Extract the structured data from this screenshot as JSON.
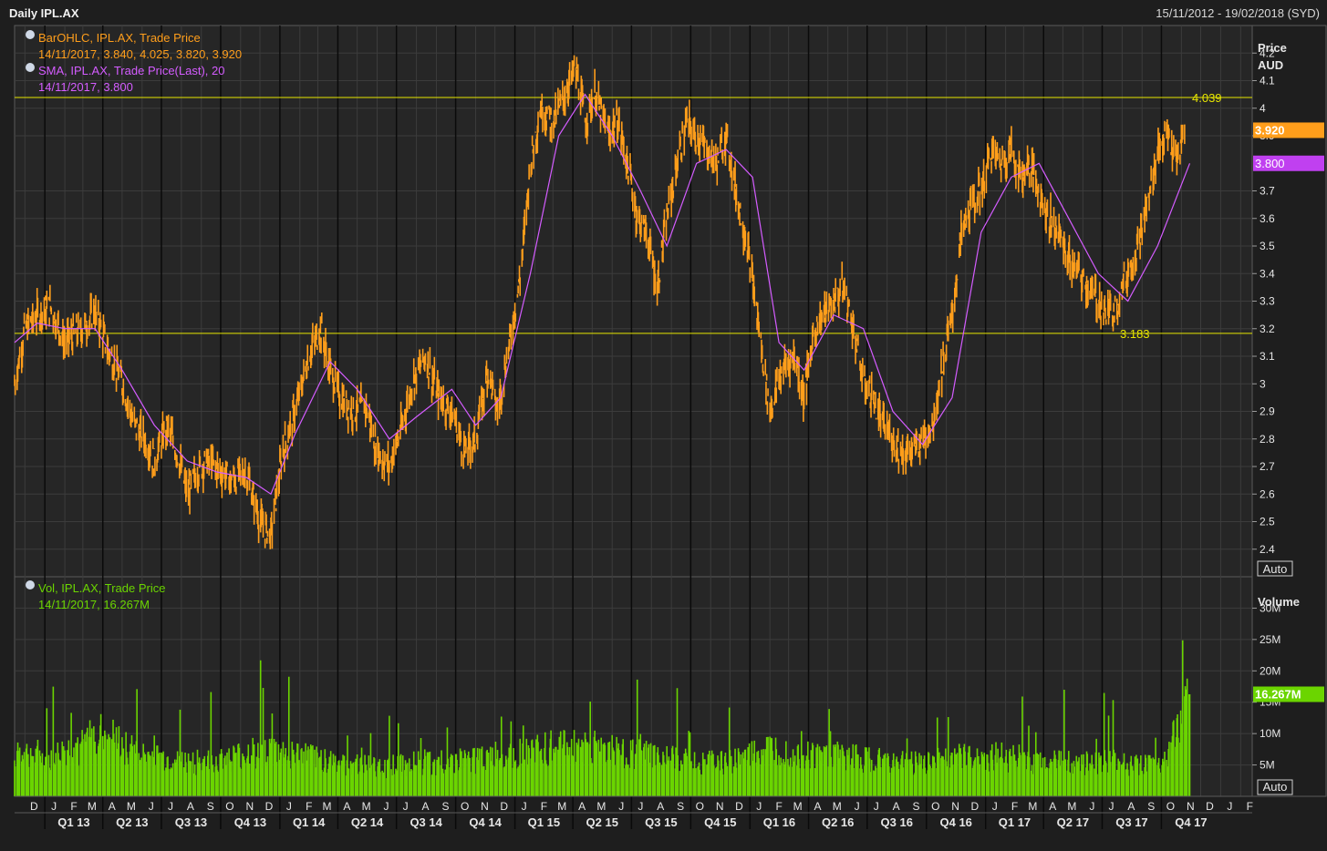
{
  "header": {
    "title": "Daily IPL.AX",
    "date_range": "15/11/2012 - 19/02/2018 (SYD)"
  },
  "price_panel": {
    "axis_title": "Price",
    "axis_unit": "AUD",
    "auto_label": "Auto",
    "legend": [
      {
        "name": "BarOHLC, IPL.AX, Trade Price",
        "value": "14/11/2017, 3.840, 4.025, 3.820, 3.920",
        "color": "#ff9e1b"
      },
      {
        "name": "SMA, IPL.AX, Trade Price(Last),  20",
        "value": "14/11/2017, 3.800",
        "color": "#d45cff"
      }
    ],
    "last_price_label": "3.920",
    "sma_label": "3.800",
    "high_line": {
      "value": 4.039,
      "label": "4.039"
    },
    "low_line": {
      "value": 3.183,
      "label": "3.183"
    }
  },
  "volume_panel": {
    "axis_title": "Volume",
    "auto_label": "Auto",
    "legend": {
      "name": "Vol, IPL.AX, Trade Price",
      "value": "14/11/2017, 16.267M",
      "color": "#6bd500"
    },
    "last_label": "16.267M"
  },
  "colors": {
    "background": "#1e1e1e",
    "grid": "#3c3c3c",
    "price": "#ff9e1b",
    "sma": "#d45cff",
    "volume": "#6bd500",
    "level_line": "#e7e600",
    "axis_text": "#e6e6e6"
  },
  "chart_data": {
    "type": "line",
    "title": "Daily IPL.AX",
    "x_range": [
      "2012-11-15",
      "2018-02-19"
    ],
    "price_ylim": [
      2.3,
      4.3
    ],
    "price_yticks": [
      2.4,
      2.5,
      2.6,
      2.7,
      2.8,
      2.9,
      3,
      3.1,
      3.2,
      3.3,
      3.4,
      3.5,
      3.6,
      3.7,
      3.9,
      4,
      4.1,
      4.2
    ],
    "price_ytick_labels": [
      "2.4",
      "2.5",
      "2.6",
      "2.7",
      "2.8",
      "2.9",
      "3",
      "3.1",
      "3.2",
      "3.3",
      "3.4",
      "3.5",
      "3.6",
      "3.7",
      "3.9",
      "4",
      "4.1",
      "4.2"
    ],
    "volume_ylim": [
      0,
      35
    ],
    "volume_yticks": [
      5,
      10,
      15,
      20,
      25,
      30
    ],
    "volume_ytick_labels": [
      "5M",
      "10M",
      "15M",
      "20M",
      "25M",
      "30M"
    ],
    "months": [
      "D",
      "J",
      "F",
      "M",
      "A",
      "M",
      "J",
      "J",
      "A",
      "S",
      "O",
      "N",
      "D",
      "J",
      "F",
      "M",
      "A",
      "M",
      "J",
      "J",
      "A",
      "S",
      "O",
      "N",
      "D",
      "J",
      "F",
      "M",
      "A",
      "M",
      "J",
      "J",
      "A",
      "S",
      "O",
      "N",
      "D",
      "J",
      "F",
      "M",
      "A",
      "M",
      "J",
      "J",
      "A",
      "S",
      "O",
      "N",
      "D",
      "J",
      "F",
      "M",
      "A",
      "M",
      "J",
      "J",
      "A",
      "S",
      "O",
      "N",
      "D",
      "J",
      "F"
    ],
    "quarters": [
      "Q1 13",
      "Q2 13",
      "Q3 13",
      "Q4 13",
      "Q1 14",
      "Q2 14",
      "Q3 14",
      "Q4 14",
      "Q1 15",
      "Q2 15",
      "Q3 15",
      "Q4 15",
      "Q1 16",
      "Q2 16",
      "Q3 16",
      "Q4 16",
      "Q1 17",
      "Q2 17",
      "Q3 17",
      "Q4 17"
    ],
    "series": [
      {
        "name": "BarOHLC, IPL.AX, Trade Price",
        "dates": [
          "2012-11-15",
          "2012-12-01",
          "2012-12-20",
          "2013-01-10",
          "2013-02-01",
          "2013-03-01",
          "2013-03-20",
          "2013-04-10",
          "2013-05-01",
          "2013-05-20",
          "2013-06-05",
          "2013-06-20",
          "2013-07-10",
          "2013-07-25",
          "2013-08-10",
          "2013-08-25",
          "2013-09-10",
          "2013-10-01",
          "2013-10-20",
          "2013-11-10",
          "2013-12-01",
          "2013-12-18",
          "2014-01-05",
          "2014-01-25",
          "2014-02-15",
          "2014-03-05",
          "2014-03-20",
          "2014-04-05",
          "2014-04-25",
          "2014-05-15",
          "2014-06-01",
          "2014-06-20",
          "2014-07-10",
          "2014-07-25",
          "2014-08-15",
          "2014-09-05",
          "2014-09-25",
          "2014-10-15",
          "2014-11-01",
          "2014-11-20",
          "2014-12-05",
          "2014-12-20",
          "2015-01-10",
          "2015-01-25",
          "2015-02-10",
          "2015-03-01",
          "2015-03-20",
          "2015-04-05",
          "2015-04-20",
          "2015-05-05",
          "2015-05-25",
          "2015-06-10",
          "2015-06-25",
          "2015-07-10",
          "2015-07-25",
          "2015-08-10",
          "2015-08-25",
          "2015-09-10",
          "2015-09-25",
          "2015-10-10",
          "2015-10-25",
          "2015-11-10",
          "2015-11-25",
          "2015-12-10",
          "2015-12-28",
          "2016-01-15",
          "2016-02-01",
          "2016-02-20",
          "2016-03-10",
          "2016-03-25",
          "2016-04-10",
          "2016-04-25",
          "2016-05-10",
          "2016-05-25",
          "2016-06-10",
          "2016-06-25",
          "2016-07-10",
          "2016-07-25",
          "2016-08-10",
          "2016-08-25",
          "2016-09-10",
          "2016-09-25",
          "2016-10-10",
          "2016-10-25",
          "2016-11-10",
          "2016-11-25",
          "2016-12-10",
          "2016-12-25",
          "2017-01-10",
          "2017-01-25",
          "2017-02-10",
          "2017-02-25",
          "2017-03-10",
          "2017-03-25",
          "2017-04-10",
          "2017-04-25",
          "2017-05-10",
          "2017-05-25",
          "2017-06-10",
          "2017-06-25",
          "2017-07-10",
          "2017-07-25",
          "2017-08-10",
          "2017-08-25",
          "2017-09-10",
          "2017-09-25",
          "2017-10-10",
          "2017-10-25",
          "2017-11-06",
          "2017-11-14"
        ],
        "values": [
          3.0,
          3.2,
          3.25,
          3.28,
          3.15,
          3.2,
          3.26,
          3.12,
          3.0,
          2.85,
          2.8,
          2.72,
          2.85,
          2.75,
          2.6,
          2.68,
          2.72,
          2.68,
          2.65,
          2.68,
          2.5,
          2.45,
          2.75,
          2.9,
          3.1,
          3.2,
          3.05,
          2.95,
          2.9,
          2.92,
          2.75,
          2.7,
          2.85,
          3.0,
          3.1,
          2.95,
          2.9,
          2.75,
          2.8,
          3.05,
          2.9,
          3.1,
          3.4,
          3.8,
          4.0,
          3.95,
          4.05,
          4.15,
          3.95,
          4.05,
          3.9,
          3.95,
          3.8,
          3.6,
          3.55,
          3.35,
          3.6,
          3.8,
          3.95,
          3.9,
          3.85,
          3.8,
          3.9,
          3.7,
          3.5,
          3.2,
          2.9,
          3.05,
          3.1,
          2.95,
          3.2,
          3.25,
          3.3,
          3.35,
          3.2,
          3.0,
          2.95,
          2.85,
          2.8,
          2.75,
          2.75,
          2.8,
          2.85,
          3.05,
          3.25,
          3.55,
          3.65,
          3.7,
          3.85,
          3.8,
          3.85,
          3.75,
          3.8,
          3.7,
          3.6,
          3.55,
          3.45,
          3.4,
          3.35,
          3.3,
          3.25,
          3.3,
          3.4,
          3.5,
          3.65,
          3.85,
          3.9,
          3.8,
          3.92
        ]
      },
      {
        "name": "SMA, IPL.AX, Trade Price(Last),  20",
        "dates": [
          "2012-11-15",
          "2012-12-20",
          "2013-02-01",
          "2013-03-20",
          "2013-05-01",
          "2013-06-20",
          "2013-08-10",
          "2013-09-25",
          "2013-11-10",
          "2013-12-18",
          "2014-01-25",
          "2014-03-20",
          "2014-05-01",
          "2014-06-20",
          "2014-08-01",
          "2014-09-25",
          "2014-11-01",
          "2014-12-10",
          "2015-01-25",
          "2015-03-10",
          "2015-04-20",
          "2015-06-01",
          "2015-07-15",
          "2015-08-25",
          "2015-10-10",
          "2015-11-25",
          "2016-01-05",
          "2016-02-15",
          "2016-03-25",
          "2016-05-10",
          "2016-06-25",
          "2016-08-10",
          "2016-09-25",
          "2016-11-10",
          "2016-12-25",
          "2017-02-10",
          "2017-03-25",
          "2017-05-10",
          "2017-06-25",
          "2017-08-10",
          "2017-09-25",
          "2017-11-14"
        ],
        "values": [
          3.15,
          3.22,
          3.2,
          3.2,
          3.05,
          2.85,
          2.72,
          2.68,
          2.66,
          2.6,
          2.82,
          3.08,
          2.98,
          2.8,
          2.88,
          2.98,
          2.85,
          2.95,
          3.4,
          3.9,
          4.05,
          3.9,
          3.7,
          3.5,
          3.8,
          3.85,
          3.75,
          3.15,
          3.05,
          3.25,
          3.2,
          2.9,
          2.78,
          2.95,
          3.55,
          3.75,
          3.8,
          3.6,
          3.4,
          3.3,
          3.5,
          3.8
        ]
      },
      {
        "name": "Vol, IPL.AX, Trade Price",
        "dates": [
          "2012-11-15",
          "2013-01-01",
          "2013-03-01",
          "2013-04-01",
          "2013-06-01",
          "2013-08-01",
          "2013-10-01",
          "2013-12-01",
          "2014-02-01",
          "2014-04-01",
          "2014-06-01",
          "2014-08-01",
          "2014-10-01",
          "2014-12-01",
          "2015-02-01",
          "2015-04-01",
          "2015-06-01",
          "2015-08-01",
          "2015-10-01",
          "2015-12-01",
          "2016-02-01",
          "2016-04-01",
          "2016-06-01",
          "2016-08-01",
          "2016-10-01",
          "2016-12-01",
          "2017-02-01",
          "2017-04-01",
          "2017-06-01",
          "2017-08-01",
          "2017-10-01",
          "2017-11-14"
        ],
        "values": [
          8,
          6,
          9,
          11,
          7,
          6,
          6,
          8,
          7,
          6,
          5,
          6,
          6,
          7,
          8,
          9,
          8,
          7,
          6,
          6,
          8,
          7,
          7,
          6,
          6,
          7,
          7,
          6,
          6,
          6,
          5,
          16.267
        ]
      }
    ]
  }
}
